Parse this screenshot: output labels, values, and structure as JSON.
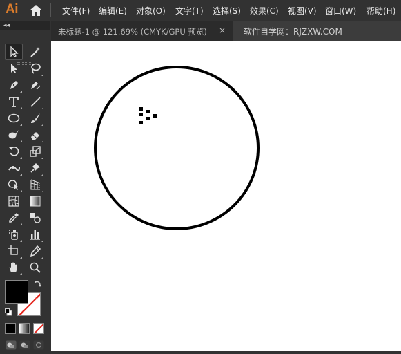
{
  "app": {
    "logo": "Ai"
  },
  "menu": {
    "items": [
      "文件(F)",
      "编辑(E)",
      "对象(O)",
      "文字(T)",
      "选择(S)",
      "效果(C)",
      "视图(V)",
      "窗口(W)",
      "帮助(H)"
    ]
  },
  "tab": {
    "title": "未标题-1 @ 121.69% (CMYK/GPU 预览)",
    "close": "×",
    "watermark": "软件自学网：RJZXW.COM"
  },
  "panel": {
    "collapse": "◂◂"
  },
  "colors": {
    "fill": "#000000",
    "stroke": "none (red slash)",
    "accent": "#d97b2b"
  },
  "tools": [
    "selection-tool",
    "magic-wand-tool",
    "direct-selection-tool",
    "lasso-tool",
    "pen-tool",
    "curvature-tool",
    "type-tool",
    "line-segment-tool",
    "ellipse-tool",
    "paintbrush-tool",
    "blob-brush-tool",
    "eraser-tool",
    "rotate-tool",
    "scale-tool",
    "width-tool",
    "puppet-warp-tool",
    "shape-builder-tool",
    "perspective-grid-tool",
    "mesh-tool",
    "gradient-tool",
    "eyedropper-tool",
    "blend-tool",
    "symbol-sprayer-tool",
    "column-graph-tool",
    "artboard-tool",
    "slice-tool",
    "hand-tool",
    "zoom-tool"
  ]
}
